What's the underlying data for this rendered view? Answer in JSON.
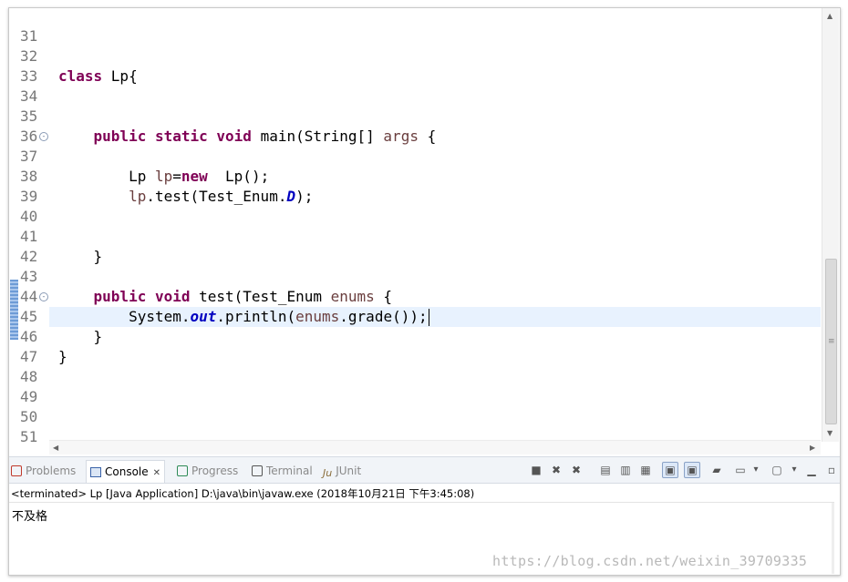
{
  "editor": {
    "lines": [
      {
        "num": "31",
        "code": []
      },
      {
        "num": "32",
        "code": []
      },
      {
        "num": "33",
        "code": [
          [
            "kw",
            "class"
          ],
          [
            "",
            "Lp{"
          ]
        ]
      },
      {
        "num": "34",
        "code": []
      },
      {
        "num": "35",
        "code": []
      },
      {
        "num": "36",
        "fold": "⊖",
        "code": [
          [
            "",
            "    "
          ],
          [
            "kw",
            "public static void"
          ],
          [
            "",
            "main(String[] "
          ],
          [
            "var",
            "args"
          ],
          [
            "",
            " {"
          ]
        ]
      },
      {
        "num": "37",
        "code": []
      },
      {
        "num": "38",
        "code": [
          [
            "",
            "        Lp "
          ],
          [
            "var",
            "lp"
          ],
          [
            "",
            "="
          ],
          [
            "kw",
            "new"
          ],
          [
            "",
            " Lp();"
          ]
        ]
      },
      {
        "num": "39",
        "code": [
          [
            "",
            "        "
          ],
          [
            "var",
            "lp"
          ],
          [
            "",
            ".test(Test_Enum."
          ],
          [
            "fld",
            "D"
          ],
          [
            "",
            ");"
          ]
        ]
      },
      {
        "num": "40",
        "code": []
      },
      {
        "num": "41",
        "code": []
      },
      {
        "num": "42",
        "code": [
          [
            "",
            "    }"
          ]
        ]
      },
      {
        "num": "43",
        "code": []
      },
      {
        "num": "44",
        "fold": "⊖",
        "code": [
          [
            "",
            "    "
          ],
          [
            "kw",
            "public void"
          ],
          [
            "",
            "test(Test_Enum "
          ],
          [
            "var",
            "enums"
          ],
          [
            "",
            " {"
          ]
        ]
      },
      {
        "num": "45",
        "current": true,
        "code": [
          [
            "",
            "        System."
          ],
          [
            "fld",
            "out"
          ],
          [
            "",
            ".println("
          ],
          [
            "var",
            "enums"
          ],
          [
            "",
            ".grade());"
          ]
        ]
      },
      {
        "num": "46",
        "code": [
          [
            "",
            "    }"
          ]
        ]
      },
      {
        "num": "47",
        "code": [
          [
            "",
            "}"
          ]
        ]
      },
      {
        "num": "48",
        "code": []
      },
      {
        "num": "49",
        "code": []
      },
      {
        "num": "50",
        "code": []
      },
      {
        "num": "51",
        "code": []
      }
    ]
  },
  "tabs": [
    {
      "id": "problems",
      "label": "Problems",
      "icon": "problems-icon",
      "color": "#c0392b"
    },
    {
      "id": "console",
      "label": "Console",
      "icon": "console-icon",
      "active": true,
      "close": "✕"
    },
    {
      "id": "progress",
      "label": "Progress",
      "icon": "progress-icon",
      "color": "#2e8b57"
    },
    {
      "id": "terminal",
      "label": "Terminal",
      "icon": "terminal-icon",
      "color": "#555555"
    },
    {
      "id": "junit",
      "label": "JUnit",
      "icon": "junit-icon",
      "prefix": "Ju",
      "color": "#8a6d3b"
    }
  ],
  "toolbar": [
    {
      "name": "terminate-icon",
      "glyph": "■"
    },
    {
      "name": "remove-launch-icon",
      "glyph": "✖"
    },
    {
      "name": "remove-all-terminated-icon",
      "glyph": "✖"
    },
    {
      "name": "scroll-lock-icon",
      "glyph": "▤"
    },
    {
      "name": "word-wrap-icon",
      "glyph": "▥"
    },
    {
      "name": "clear-console-icon",
      "glyph": "▦"
    },
    {
      "name": "show-on-stdout-icon",
      "glyph": "▣",
      "pressed": true
    },
    {
      "name": "show-on-stderr-icon",
      "glyph": "▣",
      "pressed": true
    },
    {
      "name": "pin-console-icon",
      "glyph": "▰"
    },
    {
      "name": "display-console-icon",
      "glyph": "▭"
    },
    {
      "name": "display-console-dropdown-icon",
      "glyph": "▾"
    },
    {
      "name": "open-console-icon",
      "glyph": "▢"
    },
    {
      "name": "open-console-dropdown-icon",
      "glyph": "▾"
    },
    {
      "name": "minimize-icon",
      "glyph": "▁"
    },
    {
      "name": "maximize-icon",
      "glyph": "▫"
    }
  ],
  "console": {
    "header": "<terminated> Lp [Java Application] D:\\java\\bin\\javaw.exe (2018年10月21日 下午3:45:08)",
    "output": "不及格"
  },
  "watermark": "https://blog.csdn.net/weixin_39709335"
}
